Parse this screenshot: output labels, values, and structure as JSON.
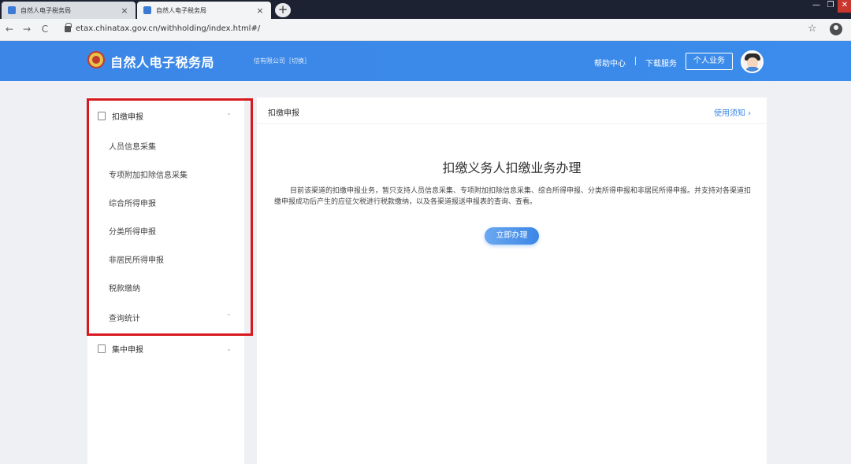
{
  "browser": {
    "tabs": [
      {
        "title": "自然人电子税务局",
        "close": "×"
      },
      {
        "title": "自然人电子税务局",
        "close": "×"
      }
    ],
    "new_tab": "+",
    "url": "etax.chinatax.gov.cn/withholding/index.html#/",
    "nav": {
      "back": "←",
      "forward": "→",
      "reload": "C"
    },
    "window": {
      "minimize": "—",
      "maximize": "❐",
      "close": "✕"
    },
    "star": "☆"
  },
  "header": {
    "brand": "自然人电子税务局",
    "company": "信有限公司［切换］",
    "help": "帮助中心",
    "download": "下载服务",
    "personal": "个人业务",
    "colors": {
      "primary": "#3b86e6",
      "highlight": "#d7181e"
    }
  },
  "sidebar": {
    "group1": {
      "label": "扣缴申报",
      "icon": "document-icon",
      "chevron": "⌃"
    },
    "items": [
      {
        "label": "人员信息采集"
      },
      {
        "label": "专项附加扣除信息采集"
      },
      {
        "label": "综合所得申报"
      },
      {
        "label": "分类所得申报"
      },
      {
        "label": "非居民所得申报"
      },
      {
        "label": "税款缴纳"
      },
      {
        "label": "查询统计",
        "chevron": "⌄"
      }
    ],
    "group2": {
      "label": "集中申报",
      "icon": "document-icon",
      "chevron": "⌄"
    }
  },
  "main": {
    "title": "扣缴申报",
    "notice": "使用须知 ›",
    "heading": "扣缴义务人扣缴业务办理",
    "description": "目前该渠道的扣缴申报业务，暂只支持人员信息采集、专项附加扣除信息采集、综合所得申报、分类所得申报和非居民所得申报。并支持对各渠道扣缴申报成功后产生的应征欠税进行税款缴纳，以及各渠道报送申报表的查询、查看。",
    "start_button": "立即办理"
  }
}
